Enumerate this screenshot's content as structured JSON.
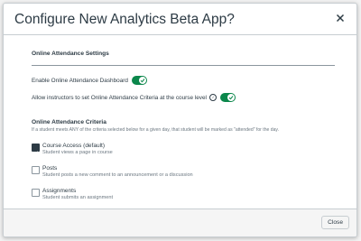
{
  "modal": {
    "title": "Configure New Analytics Beta App?",
    "close_icon": "close-icon"
  },
  "settings_section": {
    "title": "Online Attendance Settings",
    "toggles": [
      {
        "label": "Enable Online Attendance Dashboard",
        "on": true
      },
      {
        "label": "Allow instructors to set Online Attendance Criteria at the course level",
        "on": true,
        "info_icon": "info-icon"
      }
    ]
  },
  "criteria_section": {
    "title": "Online Attendance Criteria",
    "hint": "If a student meets ANY of the criteria selected below for a given day, that student will be marked as \"attended\" for the day.",
    "options": [
      {
        "label": "Course Access (default)",
        "description": "Student views a page in course",
        "checked": true
      },
      {
        "label": "Posts",
        "description": "Student posts a new comment to an announcement or a discussion",
        "checked": false
      },
      {
        "label": "Assignments",
        "description": "Student submits an assignment",
        "checked": false
      }
    ]
  },
  "footer": {
    "close_label": "Close"
  },
  "colors": {
    "toggle_on": "#0b874b",
    "text": "#2d3b45",
    "muted": "#6b7780"
  }
}
